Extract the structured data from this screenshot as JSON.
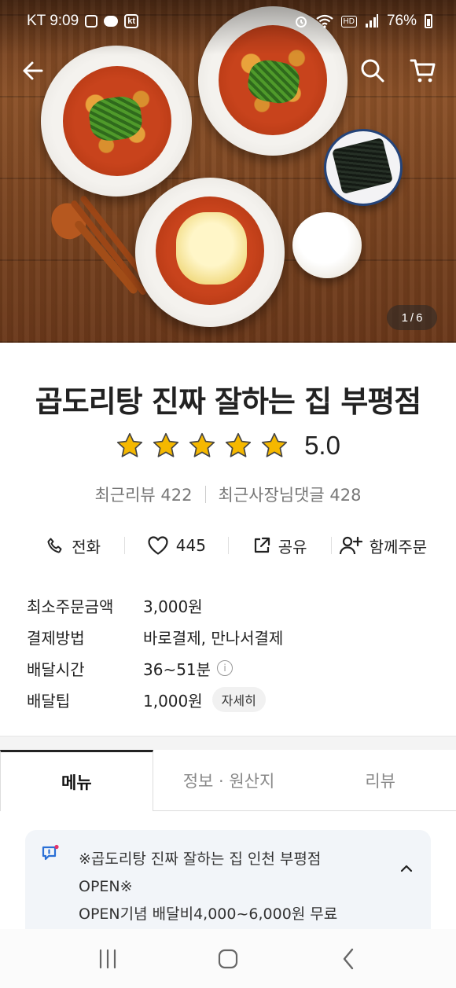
{
  "status_bar": {
    "carrier_time": "KT 9:09",
    "kt_badge": "kt",
    "hd_badge": "HD",
    "battery": "76%"
  },
  "header": {
    "back_icon": "arrow-left-icon",
    "search_icon": "search-icon",
    "cart_icon": "cart-icon"
  },
  "gallery": {
    "current": "1",
    "separator": "/",
    "total": "6"
  },
  "store": {
    "name": "곱도리탕 진짜 잘하는 집 부평점",
    "rating": "5.0",
    "stars_filled": 5,
    "star_color": "#f5b800",
    "recent_reviews": "최근리뷰 422",
    "owner_replies": "최근사장님댓글 428"
  },
  "actions": {
    "call": "전화",
    "likes": "445",
    "share": "공유",
    "group_order": "함께주문"
  },
  "info": {
    "min_order_label": "최소주문금액",
    "min_order_value": "3,000원",
    "payment_label": "결제방법",
    "payment_value": "바로결제, 만나서결제",
    "delivery_time_label": "배달시간",
    "delivery_time_value": "36~51분",
    "delivery_tip_label": "배달팁",
    "delivery_tip_value": "1,000원",
    "detail_button": "자세히"
  },
  "tabs": [
    "메뉴",
    "정보 · 원산지",
    "리뷰"
  ],
  "active_tab": "메뉴",
  "notice": {
    "line1": "※곱도리탕 진짜 잘하는 집 인천 부평점",
    "line2": "OPEN※",
    "line3": "OPEN기념 배달비4,000~6,000원 무료",
    "accent_color": "#2a6fd6"
  },
  "navbar": {
    "recents_icon": "recent-apps-icon",
    "home_icon": "home-icon",
    "back_icon": "back-icon"
  }
}
